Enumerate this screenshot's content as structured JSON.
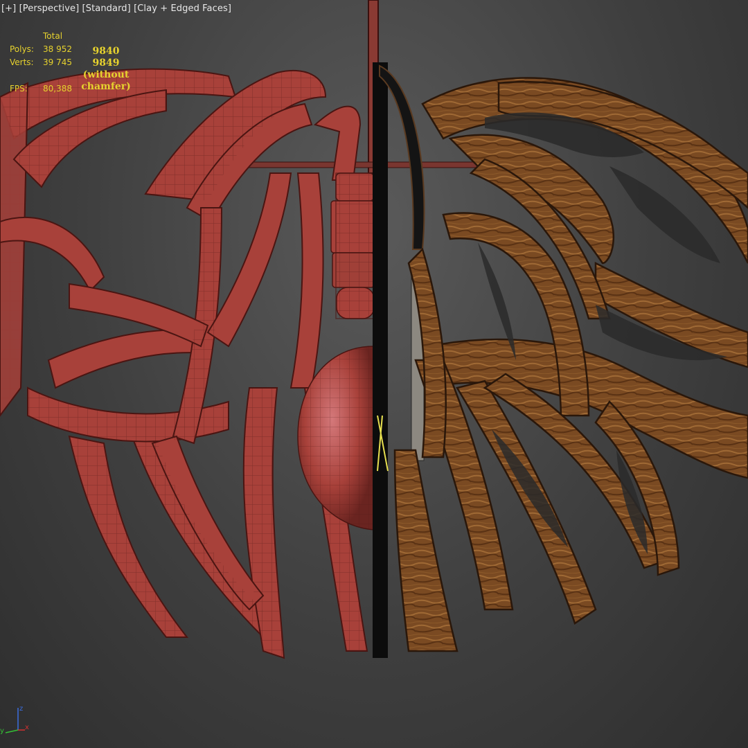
{
  "viewport": {
    "label_plus": "[+]",
    "label_view": "[Perspective]",
    "label_shading_mode": "[Standard]",
    "label_display_mode": "[Clay + Edged Faces]"
  },
  "stats": {
    "header": "Total",
    "polys_label": "Polys:",
    "polys_value": "38 952",
    "verts_label": "Verts:",
    "verts_value": "39 745",
    "fps_label": "FPS:",
    "fps_value": "80,388"
  },
  "annotation": {
    "line1": "9840",
    "line2": "9849",
    "line3": "(without",
    "line4": "chamfer)"
  },
  "axis_gizmo": {
    "x": "x",
    "y": "y",
    "z": "z"
  },
  "colors": {
    "background": "#3f3f3f",
    "stats_text": "#e6d22e",
    "clay": "#a8413a",
    "clay_edge": "#4a1512",
    "wood": "#7a4a22",
    "wood_dark": "#3e2410",
    "axis_x": "#d23030",
    "axis_y": "#35c035",
    "axis_z": "#3a6ee0"
  }
}
